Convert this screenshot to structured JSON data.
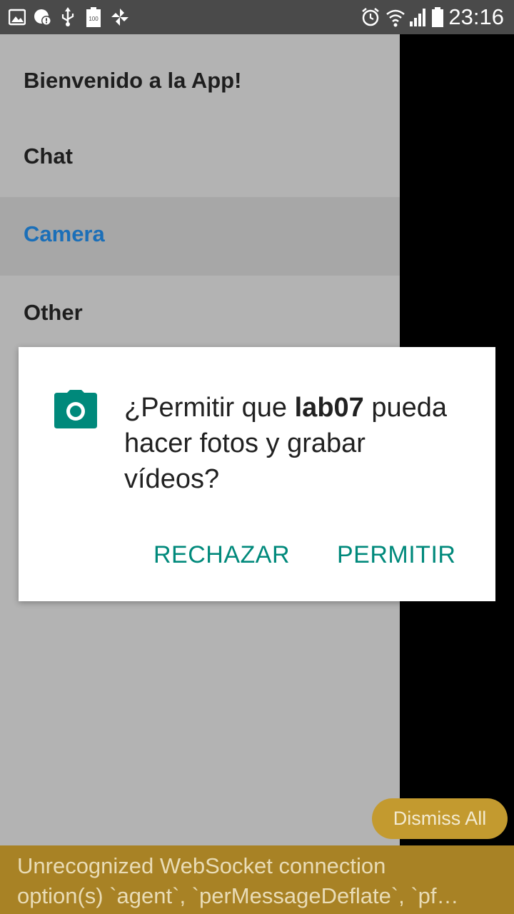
{
  "status_bar": {
    "time": "23:16",
    "icons_left": [
      "gallery-icon",
      "alert-bubble-icon",
      "usb-icon",
      "battery-100-icon",
      "pinwheel-icon"
    ],
    "icons_right": [
      "alarm-icon",
      "wifi-icon",
      "signal-icon",
      "battery-icon"
    ],
    "battery_badge": "100"
  },
  "drawer": {
    "title": "Bienvenido a la App!",
    "items": [
      {
        "label": "Chat",
        "active": false
      },
      {
        "label": "Camera",
        "active": true
      },
      {
        "label": "Other",
        "active": false
      }
    ]
  },
  "permission_dialog": {
    "text_before": "¿Permitir que ",
    "app_name": "lab07",
    "text_after": " pueda hacer fotos y grabar vídeos?",
    "deny_label": "RECHAZAR",
    "allow_label": "PERMITIR",
    "icon": "camera-icon",
    "accent_color": "#00897b"
  },
  "debug": {
    "dismiss_label": "Dismiss All",
    "warning_line1": "Unrecognized WebSocket connection",
    "warning_line2": "option(s) `agent`, `perMessageDeflate`, `pf…"
  }
}
